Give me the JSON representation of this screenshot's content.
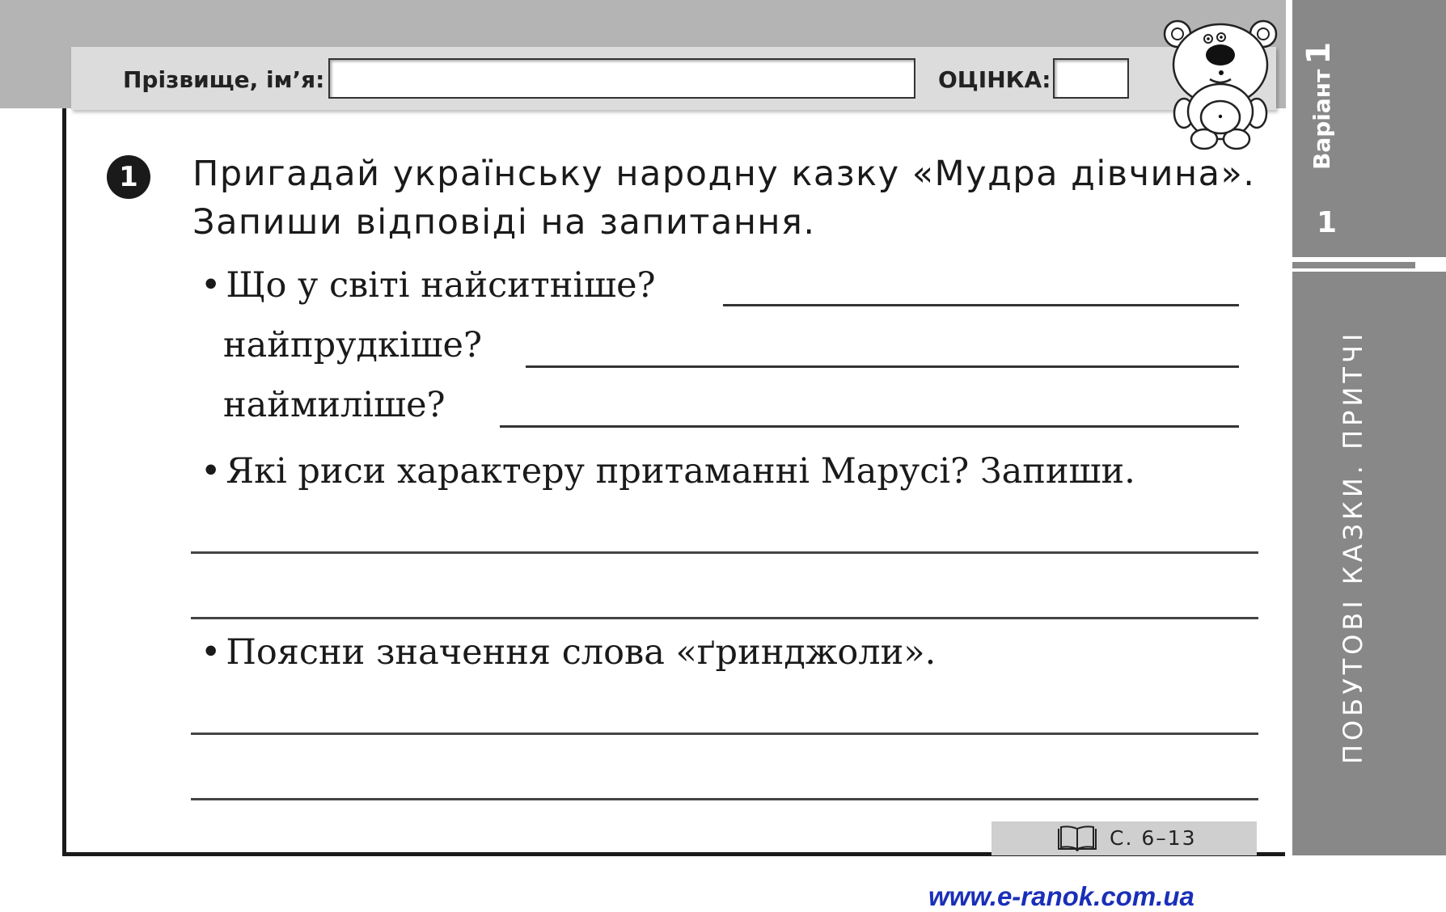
{
  "header": {
    "name_label": "Прізвище, ім’я:",
    "name_value": "",
    "grade_label": "ОЦІНКА:",
    "grade_value": ""
  },
  "sidebar": {
    "variant_label": "Варіант",
    "variant_number": "1",
    "page_number": "1",
    "section_title": "ПОБУТОВІ КАЗКИ. ПРИТЧІ"
  },
  "task": {
    "number": "1",
    "instruction": "Пригадай українську народну казку «Мудра дівчина». Запиши відповіді на запитання.",
    "questions": [
      {
        "bullet": "•",
        "text": "Що у світі найситніше?"
      },
      {
        "text": "найпрудкіше?"
      },
      {
        "text": "наймиліше?"
      },
      {
        "bullet": "•",
        "text": "Які риси характеру притаманні Марусі? Запиши."
      },
      {
        "bullet": "•",
        "text": "Поясни значення слова «ґринджоли»."
      }
    ]
  },
  "reference": {
    "icon": "book-icon",
    "text": "С. 6–13"
  },
  "footer": {
    "url": "www.e-ranok.com.ua"
  },
  "colors": {
    "band": "#b4b4b4",
    "header_bar": "#dcdcdc",
    "sidebar": "#888888",
    "url": "#1a2fb8"
  }
}
